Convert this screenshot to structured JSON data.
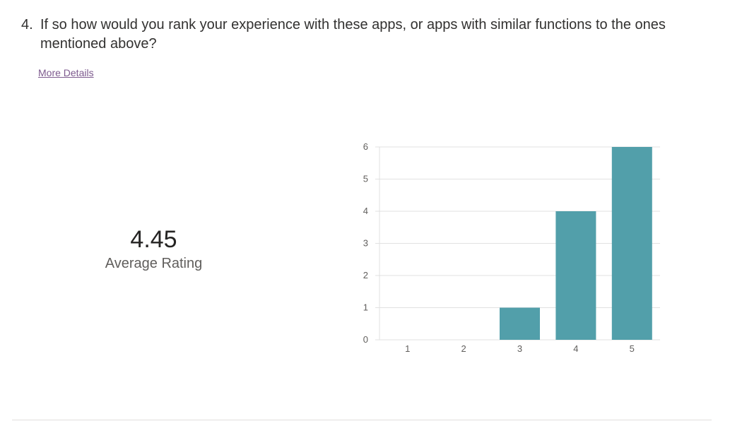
{
  "question": {
    "number": "4.",
    "text": "If so how would you rank your experience with these apps, or apps with similar functions to the ones mentioned above?"
  },
  "more_details_label": "More Details",
  "summary": {
    "average_value": "4.45",
    "average_label": "Average Rating"
  },
  "colors": {
    "bar": "#529faa",
    "grid": "#e1e1e1",
    "tick_text": "#605e5c",
    "link": "#7d5a8e"
  },
  "chart_data": {
    "type": "bar",
    "categories": [
      "1",
      "2",
      "3",
      "4",
      "5"
    ],
    "values": [
      0,
      0,
      1,
      4,
      6
    ],
    "ylim": [
      0,
      6
    ],
    "yticks": [
      0,
      1,
      2,
      3,
      4,
      5,
      6
    ],
    "grid": true
  }
}
